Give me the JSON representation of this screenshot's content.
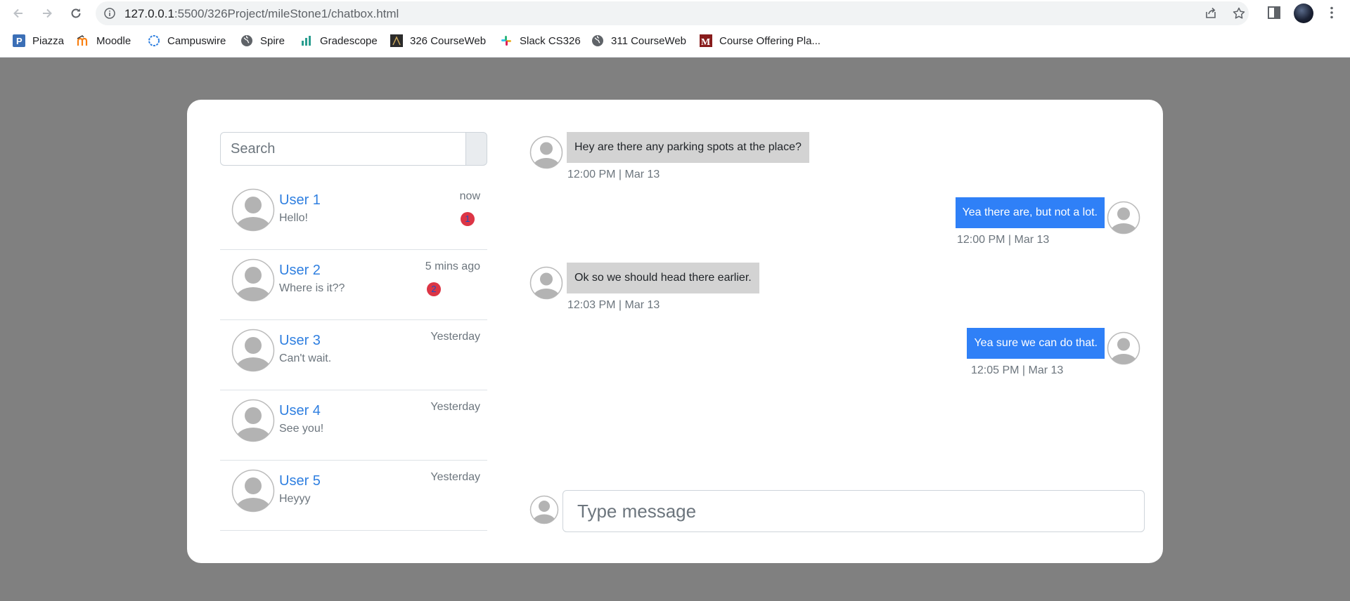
{
  "browser": {
    "url_host": "127.0.0.1",
    "url_path": ":5500/326Project/mileStone1/chatbox.html",
    "icons": [
      "back-arrow-icon",
      "forward-arrow-icon",
      "reload-icon",
      "info-icon",
      "share-icon",
      "star-icon",
      "side-panel-icon",
      "kebab-menu-icon"
    ]
  },
  "bookmarks": [
    {
      "label": "Piazza",
      "icon": "piazza-icon",
      "color": "#3b6fb6"
    },
    {
      "label": "Moodle",
      "icon": "moodle-icon",
      "color": "#f98012"
    },
    {
      "label": "Campuswire",
      "icon": "campuswire-icon",
      "color": "#2d7fe0"
    },
    {
      "label": "Spire",
      "icon": "globe-icon",
      "color": "#5f6368"
    },
    {
      "label": "Gradescope",
      "icon": "gradescope-icon",
      "color": "#2a9d8f"
    },
    {
      "label": "326 CourseWeb",
      "icon": "courseweb-icon",
      "color": "#3a3a3a"
    },
    {
      "label": "Slack CS326",
      "icon": "slack-icon",
      "color": "#e01e5a"
    },
    {
      "label": "311 CourseWeb",
      "icon": "globe-icon",
      "color": "#5f6368"
    },
    {
      "label": "Course Offering Pla...",
      "icon": "umass-icon",
      "color": "#881c1c"
    }
  ],
  "search": {
    "placeholder": "Search"
  },
  "contacts": [
    {
      "name": "User 1",
      "preview": "Hello!",
      "time": "now",
      "unread": "1"
    },
    {
      "name": "User 2",
      "preview": "Where is it??",
      "time": "5 mins ago",
      "unread": "2"
    },
    {
      "name": "User 3",
      "preview": "Can't wait.",
      "time": "Yesterday",
      "unread": null
    },
    {
      "name": "User 4",
      "preview": "See you!",
      "time": "Yesterday",
      "unread": null
    },
    {
      "name": "User 5",
      "preview": "Heyyy",
      "time": "Yesterday",
      "unread": null
    }
  ],
  "messages": [
    {
      "direction": "incoming",
      "text": "Hey are there any parking spots at the place?",
      "time": "12:00 PM | Mar 13"
    },
    {
      "direction": "outgoing",
      "text": "Yea there are, but not a lot.",
      "time": "12:00 PM | Mar 13"
    },
    {
      "direction": "incoming",
      "text": "Ok so we should head there earlier.",
      "time": "12:03 PM | Mar 13"
    },
    {
      "direction": "outgoing",
      "text": "Yea sure we can do that.",
      "time": "12:05 PM | Mar 13"
    }
  ],
  "composer": {
    "placeholder": "Type message"
  },
  "colors": {
    "page_background": "#808080",
    "incoming_bubble": "#d3d3d3",
    "outgoing_bubble": "#2f80f7",
    "contact_name": "#2f7fe0",
    "badge": "#dc3545"
  }
}
